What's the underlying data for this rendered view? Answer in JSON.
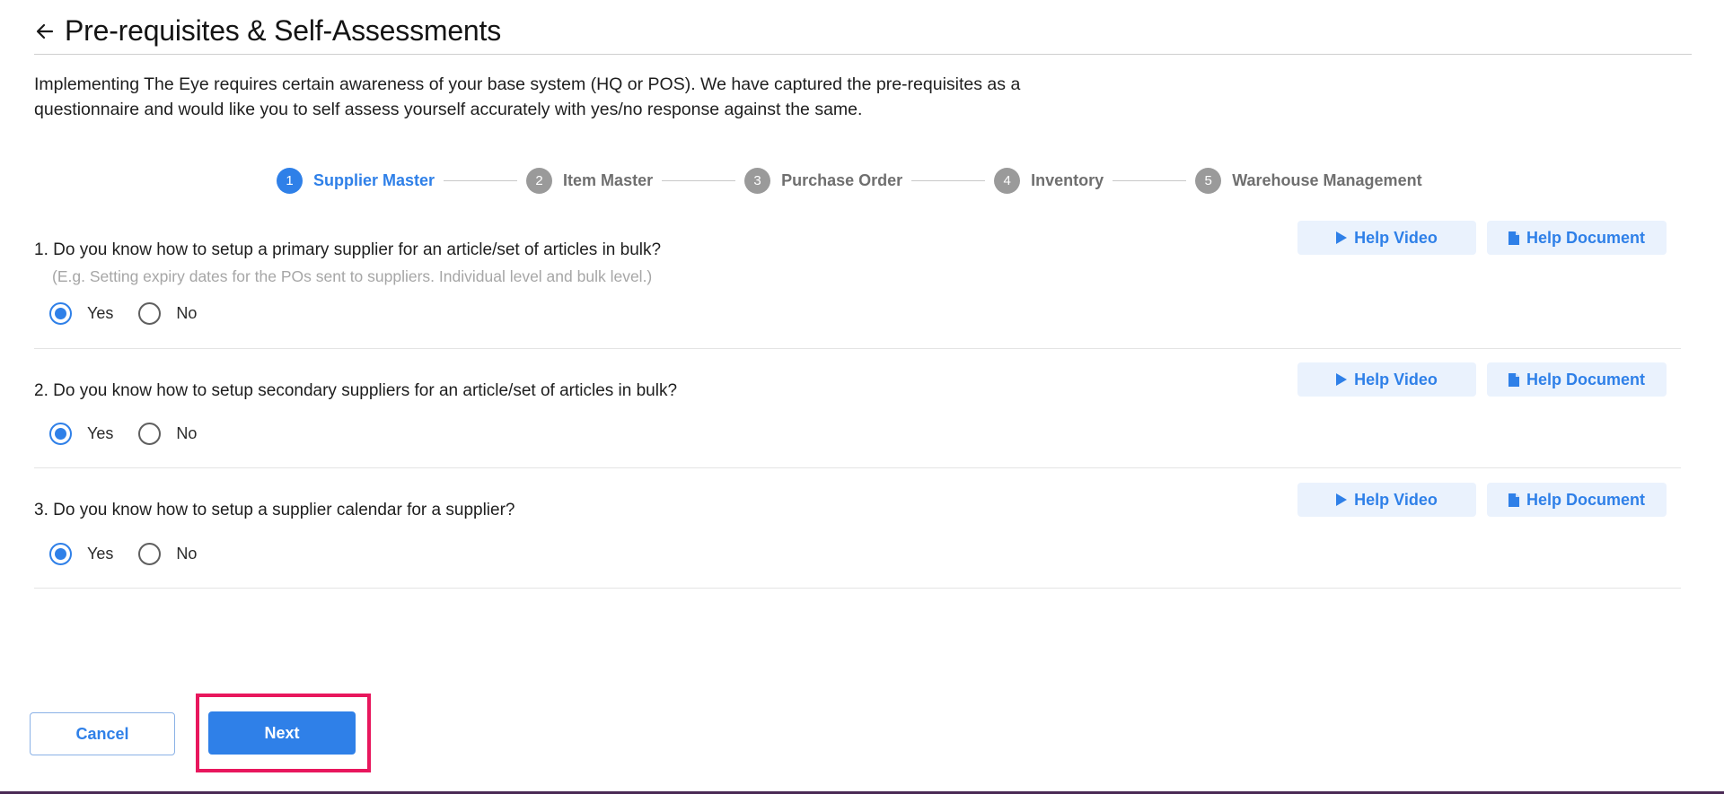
{
  "header": {
    "title": "Pre-requisites & Self-Assessments",
    "back_icon": "arrow-left-icon"
  },
  "intro": "Implementing The Eye requires certain awareness of your base system (HQ or POS). We have captured the pre-requisites as a questionnaire and would like you to self assess yourself accurately with yes/no response against the same.",
  "stepper": {
    "steps": [
      {
        "number": "1",
        "label": "Supplier Master",
        "active": true
      },
      {
        "number": "2",
        "label": "Item Master",
        "active": false
      },
      {
        "number": "3",
        "label": "Purchase Order",
        "active": false
      },
      {
        "number": "4",
        "label": "Inventory",
        "active": false
      },
      {
        "number": "5",
        "label": "Warehouse Management",
        "active": false
      }
    ]
  },
  "questions": [
    {
      "text": "1. Do you know how to setup a primary supplier for an article/set of articles in bulk?",
      "hint": "(E.g. Setting expiry dates for the POs sent to suppliers. Individual level and bulk level.)",
      "yes_label": "Yes",
      "no_label": "No",
      "selected": "Yes",
      "help_video_label": "Help Video",
      "help_document_label": "Help Document"
    },
    {
      "text": "2. Do you know how to setup secondary suppliers for an article/set of articles in bulk?",
      "hint": "",
      "yes_label": "Yes",
      "no_label": "No",
      "selected": "Yes",
      "help_video_label": "Help Video",
      "help_document_label": "Help Document"
    },
    {
      "text": "3. Do you know how to setup a supplier calendar for a supplier?",
      "hint": "",
      "yes_label": "Yes",
      "no_label": "No",
      "selected": "Yes",
      "help_video_label": "Help Video",
      "help_document_label": "Help Document"
    }
  ],
  "footer": {
    "cancel_label": "Cancel",
    "next_label": "Next"
  },
  "colors": {
    "accent": "#2f80e8",
    "highlight": "#e8175d",
    "help_bg": "#eaf2fd"
  }
}
